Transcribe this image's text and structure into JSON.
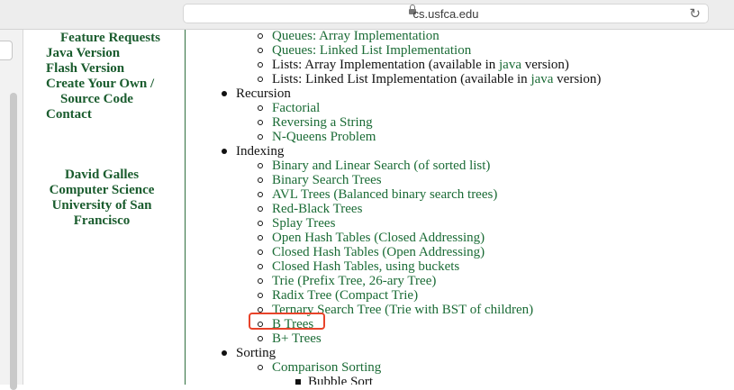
{
  "browser": {
    "url": "cs.usfca.edu"
  },
  "nav": {
    "feature_requests": "Feature Requests",
    "java_version": "Java Version",
    "flash_version": "Flash Version",
    "create_own": "Create Your Own /",
    "source_code": "Source Code",
    "contact": "Contact",
    "author": "David Galles",
    "dept": "Computer Science",
    "univ1": "University of San",
    "univ2": "Francisco"
  },
  "list": {
    "queues_array": "Queues: Array Implementation",
    "queues_linked": "Queues: Linked List Implementation",
    "lists_array_pre": "Lists: Array Implementation (available in ",
    "lists_linked_pre": "Lists: Linked List Implementation (available in ",
    "java": "java",
    "version_post": " version)",
    "recursion": "Recursion",
    "factorial": "Factorial",
    "reversing": "Reversing a String",
    "nqueens": "N-Queens Problem",
    "indexing": "Indexing",
    "binary_linear": "Binary and Linear Search (of sorted list)",
    "bst": "Binary Search Trees",
    "avl": "AVL Trees (Balanced binary search trees)",
    "redblack": "Red-Black Trees",
    "splay": "Splay Trees",
    "open_hash": "Open Hash Tables (Closed Addressing)",
    "closed_hash": "Closed Hash Tables (Open Addressing)",
    "closed_hash_buckets": "Closed Hash Tables, using buckets",
    "trie": "Trie (Prefix Tree, 26-ary Tree)",
    "radix": "Radix Tree (Compact Trie)",
    "ternary": "Ternary Search Tree (Trie with BST of children)",
    "btrees": "B Trees",
    "bplus": "B+ Trees",
    "sorting": "Sorting",
    "comparison": "Comparison Sorting",
    "bubble": "Bubble Sort"
  },
  "colors": {
    "link": "#1a6b35",
    "visited_link": "#f0b83a",
    "nav_text": "#1a5c2e",
    "highlight_box": "#e8432a"
  },
  "icons": [
    "lock-icon",
    "reload-icon"
  ]
}
